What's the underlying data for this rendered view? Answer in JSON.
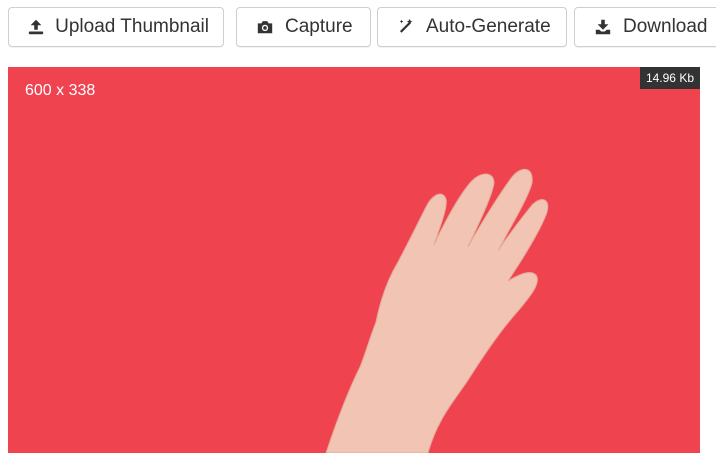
{
  "toolbar": {
    "upload_label": "Upload Thumbnail",
    "capture_label": "Capture",
    "autogenerate_label": "Auto-Generate",
    "download_label": "Download",
    "upload_icon": "upload-icon",
    "capture_icon": "camera-icon",
    "autogenerate_icon": "magic-wand-icon",
    "download_icon": "download-icon"
  },
  "thumbnail": {
    "dimensions": "600 x 338",
    "file_size": "14.96 Kb",
    "background_color": "#ef4350"
  }
}
